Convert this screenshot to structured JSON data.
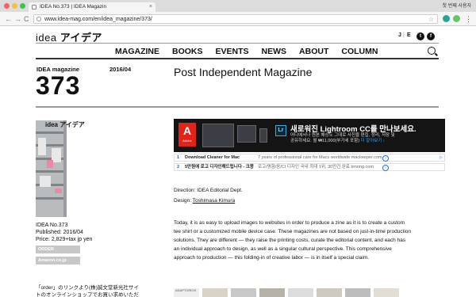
{
  "browser": {
    "tab_title": "IDEA No.373 | IDEA Magazin",
    "tab_close": "×",
    "profile": "첫 번째 사용자",
    "url": "www.idea-mag.com/en/idea_magazine/373/",
    "back": "←",
    "forward": "→",
    "reload": "C"
  },
  "site": {
    "logo_latin": "idea",
    "logo_katakana": "アイデア",
    "social": [
      "J",
      "E"
    ],
    "nav": [
      "MAGAZINE",
      "BOOKS",
      "EVENTS",
      "NEWS",
      "ABOUT",
      "COLUMN"
    ]
  },
  "issue": {
    "label": "IDEA magazine",
    "number": "373",
    "date": "2016/04",
    "title": "Post Independent Magazine",
    "cover_brand": "idea アイデア",
    "meta_name": "IDEA No.373",
    "meta_published": "Published: 2016/04",
    "meta_price": "Price: 2,829+tax jp yen",
    "order_label": "ORDER",
    "amazon_label": "Amazon.co.jp",
    "note": "「order」のリンクより(株)誠文堂新光社サイトのオンラインショップでお買い求めいただけま"
  },
  "ad": {
    "brand": "Adobe",
    "headline": "새로워진 Lightroom CC를 만나보세요.",
    "sub1": "어디에서나 원본 해상도 그대로 사진을 편집, 정리, 저장 및",
    "sub2": "공유하세요. 월 ₩11,000(부가세 포함)",
    "sub_link": "더 알아보기 ›",
    "rows": [
      {
        "num": "1",
        "title": "Download Cleaner for Mac",
        "desc": "7 years of professional care for Macs worldwide  mackeeper.com"
      },
      {
        "num": "2",
        "title": "5만원에 로고 디자인해드립니다 - 크몽",
        "desc": "로고/명함/응/CI 디자인 국내 최대 1위, 30만건 완료  kmong.com"
      }
    ]
  },
  "credits": {
    "direction": "Direction: IDEA Editorial Dept.",
    "design_label": "Design: ",
    "design_name": "Toshimasa Kimura"
  },
  "paragraph": "Today, it is as easy to upload images to websites in order to produce a zine as it is to create a custom tee shirt or a customized mobile device case. These magazines are not based on just-in-time production solutions. They are different — they raise the printing costs, curate the editorial content, and each has an individual approach to design, as well as a singular cultural perspective. This comprehensive approach to production — this folding-in of creative labor — is in itself a special claim.",
  "thumbs": [
    "ADAPTORIOS",
    "",
    "",
    "",
    "",
    "",
    "",
    ""
  ],
  "colors": {
    "adobe_red": "#e2231a",
    "lightroom_blue": "#3fa7d9",
    "link_blue": "#1a73e8"
  }
}
